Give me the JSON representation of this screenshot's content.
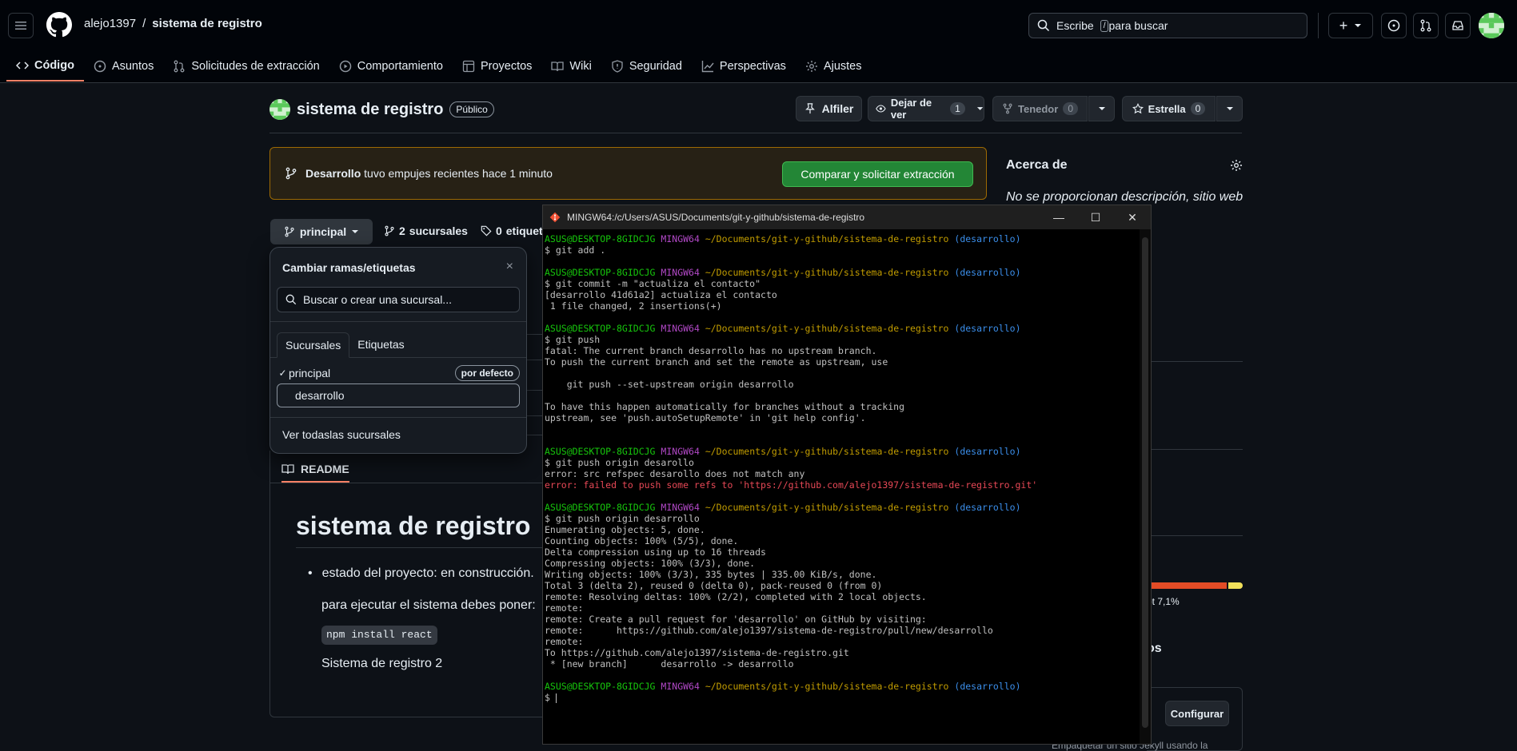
{
  "header": {
    "owner": "alejo1397",
    "separator": "/",
    "repo": "sistema de registro",
    "search_placeholder": "Escribe",
    "search_key": "/",
    "search_suffix": "para buscar"
  },
  "nav": {
    "tabs": [
      {
        "label": "Código",
        "icon": "code-icon",
        "active": true
      },
      {
        "label": "Asuntos",
        "icon": "issue-icon"
      },
      {
        "label": "Solicitudes de extracción",
        "icon": "pull-request-icon"
      },
      {
        "label": "Comportamiento",
        "icon": "play-icon"
      },
      {
        "label": "Proyectos",
        "icon": "table-icon"
      },
      {
        "label": "Wiki",
        "icon": "book-icon"
      },
      {
        "label": "Seguridad",
        "icon": "shield-icon"
      },
      {
        "label": "Perspectivas",
        "icon": "graph-icon"
      },
      {
        "label": "Ajustes",
        "icon": "gear-icon"
      }
    ]
  },
  "repo_header": {
    "name": "sistema de registro",
    "visibility": "Público",
    "pin_label": "Alfiler",
    "watch_label": "Dejar de ver",
    "watch_count": "1",
    "fork_label": "Tenedor",
    "fork_count": "0",
    "star_label": "Estrella",
    "star_count": "0"
  },
  "flash": {
    "branch": "Desarrollo",
    "message": "tuvo empujes recientes hace 1 minuto",
    "button": "Comparar y solicitar extracción"
  },
  "branch_bar": {
    "current": "principal",
    "branches_count": "2",
    "branches_label": "sucursales",
    "tags_count": "0",
    "tags_label": "etiquetas"
  },
  "branch_popup": {
    "title": "Cambiar ramas/etiquetas",
    "close": "×",
    "search_placeholder": "Buscar o crear una sucursal...",
    "tab_branches": "Sucursales",
    "tab_tags": "Etiquetas",
    "branches": [
      {
        "name": "principal",
        "checked": true,
        "badge": "por defecto"
      },
      {
        "name": "desarrollo",
        "checked": false,
        "badge": ""
      }
    ],
    "view_all": "Ver todaslas sucursales"
  },
  "readme": {
    "tab": "README",
    "heading": "sistema de registro",
    "bullet": "estado del proyecto: en construcción.",
    "line2": "para ejecutar el sistema debes poner:",
    "code": "npm install react",
    "line4": "Sistema de registro 2"
  },
  "sidebar": {
    "about_title": "Acerca de",
    "description": "No se proporcionan descripción, sitio web",
    "lang_text": "ot 7,1%",
    "partial_text": "os",
    "configure_button": "Configurar",
    "footer_text": "Empaquetar un sitio Jekyll usando la"
  },
  "terminal": {
    "title": "MINGW64:/c/Users/ASUS/Documents/git-y-github/sistema-de-registro",
    "prompt_user": "ASUS@DESKTOP-8GIDCJG",
    "prompt_host": "MINGW64",
    "prompt_path": "~/Documents/git-y-github/sistema-de-registro",
    "prompt_branch": "(desarrollo)",
    "blocks": [
      {
        "cmd": "$ git add .",
        "out": []
      },
      {
        "cmd": "$ git commit -m \"actualiza el contacto\"",
        "out": [
          "[desarrollo 41d61a2] actualiza el contacto",
          " 1 file changed, 2 insertions(+)"
        ]
      },
      {
        "cmd": "$ git push",
        "out": [
          "fatal: The current branch desarrollo has no upstream branch.",
          "To push the current branch and set the remote as upstream, use",
          "",
          "    git push --set-upstream origin desarrollo",
          "",
          "To have this happen automatically for branches without a tracking",
          "upstream, see 'push.autoSetupRemote' in 'git help config'.",
          ""
        ]
      },
      {
        "cmd": "$ git push origin desarollo",
        "out": [
          "error: src refspec desarollo does not match any"
        ],
        "err": [
          "error: failed to push some refs to 'https://github.com/alejo1397/sistema-de-registro.git'"
        ]
      },
      {
        "cmd": "$ git push origin desarrollo",
        "out": [
          "Enumerating objects: 5, done.",
          "Counting objects: 100% (5/5), done.",
          "Delta compression using up to 16 threads",
          "Compressing objects: 100% (3/3), done.",
          "Writing objects: 100% (3/3), 335 bytes | 335.00 KiB/s, done.",
          "Total 3 (delta 2), reused 0 (delta 0), pack-reused 0 (from 0)",
          "remote: Resolving deltas: 100% (2/2), completed with 2 local objects.",
          "remote:",
          "remote: Create a pull request for 'desarrollo' on GitHub by visiting:",
          "remote:      https://github.com/alejo1397/sistema-de-registro/pull/new/desarrollo",
          "remote:",
          "To https://github.com/alejo1397/sistema-de-registro.git",
          " * [new branch]      desarrollo -> desarrollo"
        ]
      },
      {
        "cmd": "$ ",
        "out": [],
        "cursor": true
      }
    ]
  },
  "colors": {
    "accent_tab": "#f78166",
    "green_button": "#238636",
    "lang_bar": [
      "#e34c26",
      "#f1e05a"
    ]
  }
}
